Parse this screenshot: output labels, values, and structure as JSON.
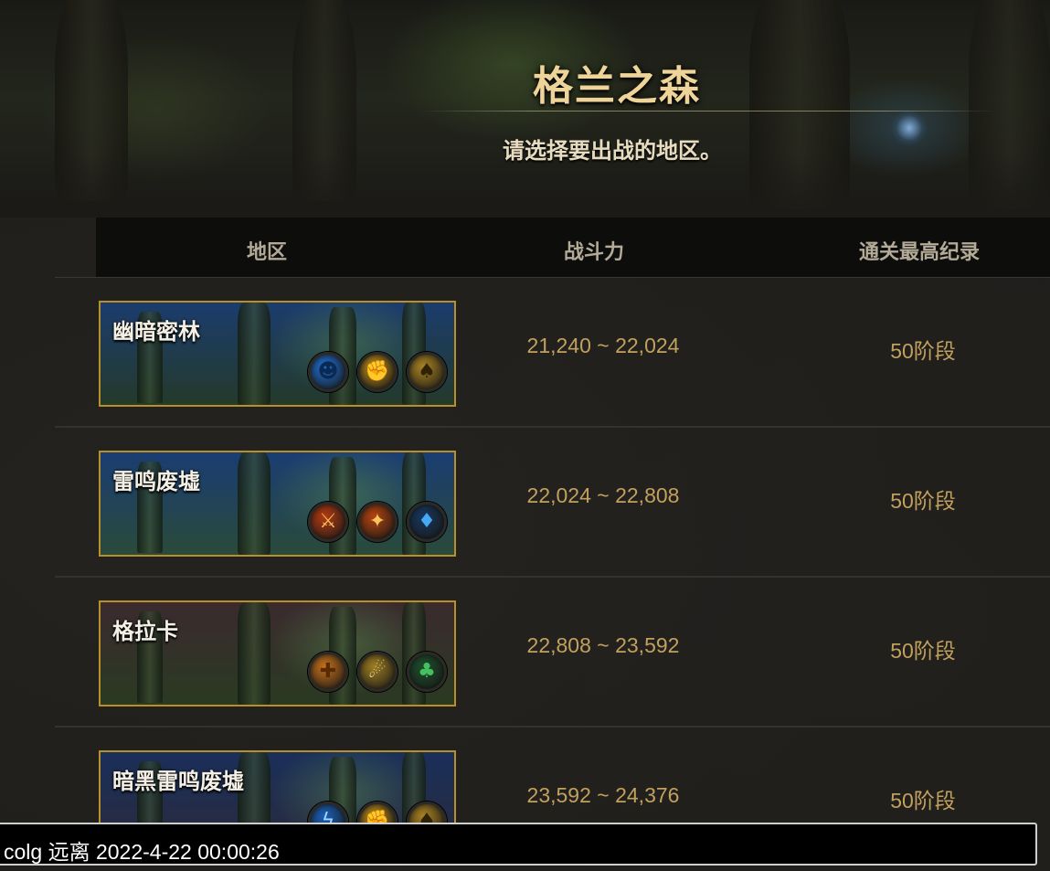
{
  "header": {
    "title": "格兰之森",
    "subtitle": "请选择要出战的地区。"
  },
  "table": {
    "columns": {
      "area": "地区",
      "power": "战斗力",
      "record": "通关最高纪录"
    },
    "rows": [
      {
        "name": "幽暗密林",
        "power": "21,240 ~ 22,024",
        "record": "50阶段",
        "scene_colors": [
          "#1b3c6e",
          "#243a2a"
        ],
        "modifiers": [
          {
            "icon": "skull-icon",
            "glyph": "☻",
            "bg": "#1f6ed0",
            "fg": "#0a2a55"
          },
          {
            "icon": "fist-icon",
            "glyph": "✊",
            "bg": "#b88a1c",
            "fg": "#4a3305"
          },
          {
            "icon": "spade-icon",
            "glyph": "♠",
            "bg": "#a98222",
            "fg": "#2e2306"
          }
        ]
      },
      {
        "name": "雷鸣废墟",
        "power": "22,024 ~ 22,808",
        "record": "50阶段",
        "scene_colors": [
          "#1a3d73",
          "#2a4a3a"
        ],
        "modifiers": [
          {
            "icon": "crossed-swords-icon",
            "glyph": "⚔",
            "bg": "#b33a12",
            "fg": "#f5c05a"
          },
          {
            "icon": "torch-icon",
            "glyph": "✦",
            "bg": "#b2420f",
            "fg": "#f6c45a"
          },
          {
            "icon": "diamond-icon",
            "glyph": "♦",
            "bg": "#16365c",
            "fg": "#45aaf5"
          }
        ]
      },
      {
        "name": "格拉卡",
        "power": "22,808 ~ 23,592",
        "record": "50阶段",
        "scene_colors": [
          "#3b2a2e",
          "#2a3a22"
        ],
        "modifiers": [
          {
            "icon": "totem-icon",
            "glyph": "✚",
            "bg": "#c4701a",
            "fg": "#5a2a05"
          },
          {
            "icon": "boot-icon",
            "glyph": "☄",
            "bg": "#9c7c22",
            "fg": "#f0d88a"
          },
          {
            "icon": "club-icon",
            "glyph": "♣",
            "bg": "#1b4d2a",
            "fg": "#45c060"
          }
        ]
      },
      {
        "name": "暗黑雷鸣废墟",
        "power": "23,592 ~ 24,376",
        "record": "50阶段",
        "scene_colors": [
          "#1a2f5a",
          "#2a2a3a"
        ],
        "modifiers": [
          {
            "icon": "lightning-icon",
            "glyph": "ϟ",
            "bg": "#1a60b8",
            "fg": "#a0d8ff"
          },
          {
            "icon": "fist-icon",
            "glyph": "✊",
            "bg": "#b88a1c",
            "fg": "#4a3305"
          },
          {
            "icon": "spade-icon",
            "glyph": "♠",
            "bg": "#a98222",
            "fg": "#2e2306"
          }
        ]
      }
    ]
  },
  "watermark": "colg 远离 2022-4-22 00:00:26"
}
